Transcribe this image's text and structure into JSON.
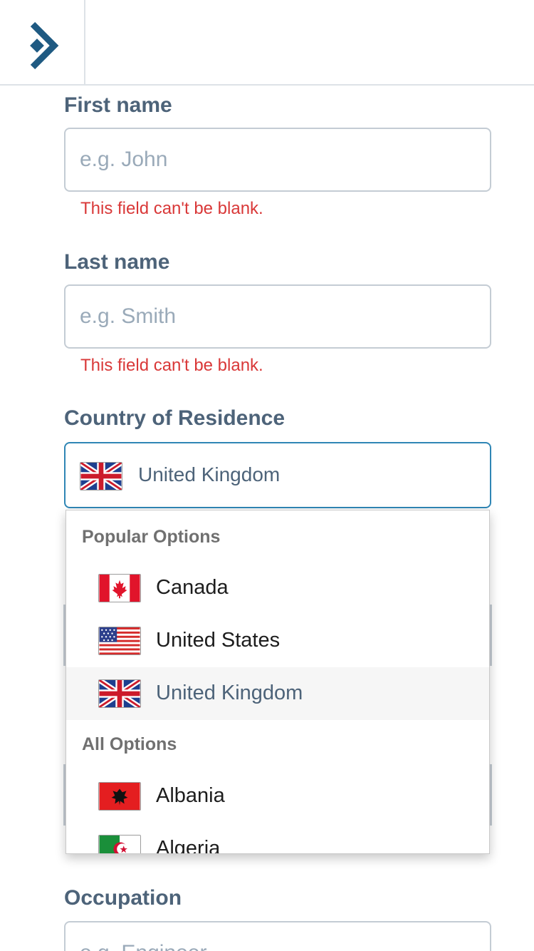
{
  "header": {
    "logo": "brand-logo"
  },
  "form": {
    "first_name": {
      "label": "First name",
      "placeholder": "e.g. John",
      "value": "",
      "error": "This field can't be blank."
    },
    "last_name": {
      "label": "Last name",
      "placeholder": "e.g. Smith",
      "value": "",
      "error": "This field can't be blank."
    },
    "country": {
      "label": "Country of Residence",
      "selected": "United Kingdom",
      "selected_flag": "flag-uk-icon",
      "dropdown": {
        "popular_label": "Popular Options",
        "popular": [
          {
            "label": "Canada",
            "flag": "flag-canada-icon"
          },
          {
            "label": "United States",
            "flag": "flag-us-icon"
          },
          {
            "label": "United Kingdom",
            "flag": "flag-uk-icon",
            "highlighted": true
          }
        ],
        "all_label": "All Options",
        "all": [
          {
            "label": "Albania",
            "flag": "flag-albania-icon"
          },
          {
            "label": "Algeria",
            "flag": "flag-algeria-icon"
          }
        ]
      }
    },
    "occupation": {
      "label": "Occupation",
      "placeholder": "e.g. Engineer",
      "value": ""
    }
  },
  "colors": {
    "error": "#d93838",
    "focus": "#2f86b5",
    "label": "#4d6379",
    "brand": "#1f5a82"
  }
}
